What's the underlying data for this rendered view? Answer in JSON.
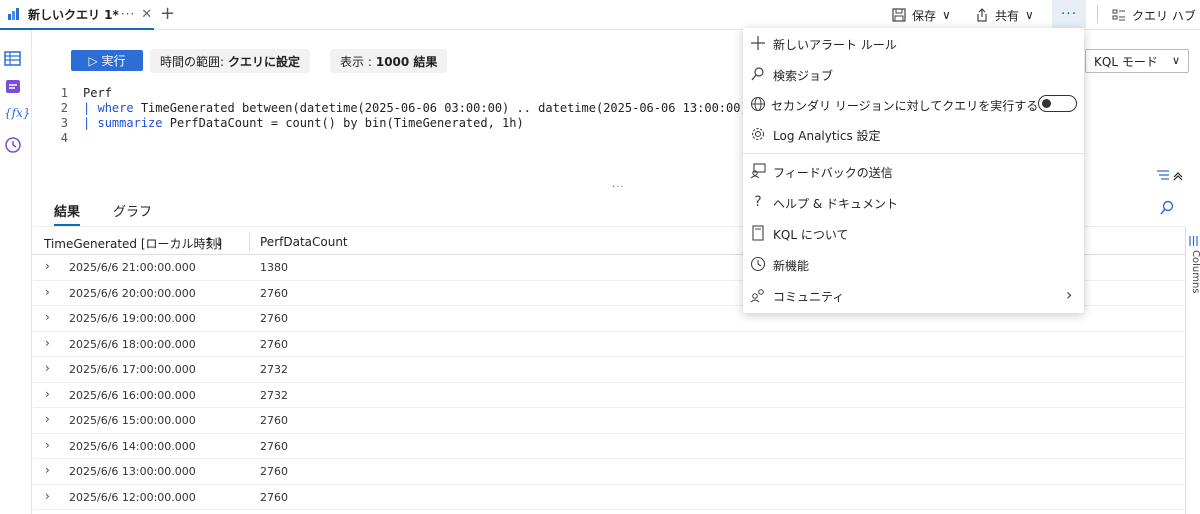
{
  "tabbar": {
    "tab_label": "新しいクエリ 1*",
    "tab_more": "···",
    "tab_close": "✕",
    "add_tab": "+",
    "save_label": "保存",
    "share_label": "共有",
    "more_label": "···",
    "query_hub_label": "クエリ ハブ"
  },
  "toolbar": {
    "run_label": "▷ 実行",
    "time_range_label": "時間の範囲:",
    "time_range_value": "クエリに設定",
    "display_label": "表示 :",
    "display_value": "1000 結果",
    "kql_mode": "KQL モード"
  },
  "editor": {
    "lines": [
      {
        "num": "1",
        "text": "Perf"
      },
      {
        "num": "2",
        "pipe": "|",
        "kw": "where",
        "text": " TimeGenerated between(datetime(2025-06-06 03:00:00) .. datetime(2025-06-06 13:00:00))"
      },
      {
        "num": "3",
        "pipe": "|",
        "kw": "summarize",
        "text": " PerfDataCount = count() by bin(TimeGenerated, 1h)"
      },
      {
        "num": "4",
        "text": ""
      }
    ]
  },
  "splitter": "···",
  "results": {
    "tabs": [
      "結果",
      "グラフ"
    ],
    "columns": [
      "TimeGenerated [ローカル時刻]",
      "PerfDataCount"
    ],
    "sort_indicator": "↑↓",
    "rows": [
      [
        "2025/6/6 21:00:00.000",
        "1380"
      ],
      [
        "2025/6/6 20:00:00.000",
        "2760"
      ],
      [
        "2025/6/6 19:00:00.000",
        "2760"
      ],
      [
        "2025/6/6 18:00:00.000",
        "2760"
      ],
      [
        "2025/6/6 17:00:00.000",
        "2732"
      ],
      [
        "2025/6/6 16:00:00.000",
        "2732"
      ],
      [
        "2025/6/6 15:00:00.000",
        "2760"
      ],
      [
        "2025/6/6 14:00:00.000",
        "2760"
      ],
      [
        "2025/6/6 13:00:00.000",
        "2760"
      ],
      [
        "2025/6/6 12:00:00.000",
        "2760"
      ]
    ],
    "columns_panel": "Columns"
  },
  "menu": {
    "items": [
      {
        "label": "新しいアラート ルール",
        "icon": "plus-icon"
      },
      {
        "label": "検索ジョブ",
        "icon": "search-job-icon"
      },
      {
        "label": "セカンダリ リージョンに対してクエリを実行する",
        "icon": "globe-icon"
      },
      {
        "label": "Log Analytics 設定",
        "icon": "gear-icon"
      },
      {
        "label": "フィードバックの送信",
        "icon": "feedback-icon"
      },
      {
        "label": "ヘルプ & ドキュメント",
        "icon": "help-icon"
      },
      {
        "label": "KQL について",
        "icon": "book-icon"
      },
      {
        "label": "新機能",
        "icon": "clock-icon"
      },
      {
        "label": "コミュニティ",
        "icon": "community-icon"
      }
    ],
    "chevron": "›"
  },
  "colors": {
    "accent": "#0f6cbd",
    "run_button": "#2c6ed5",
    "keyword": "#1f4fd6"
  }
}
